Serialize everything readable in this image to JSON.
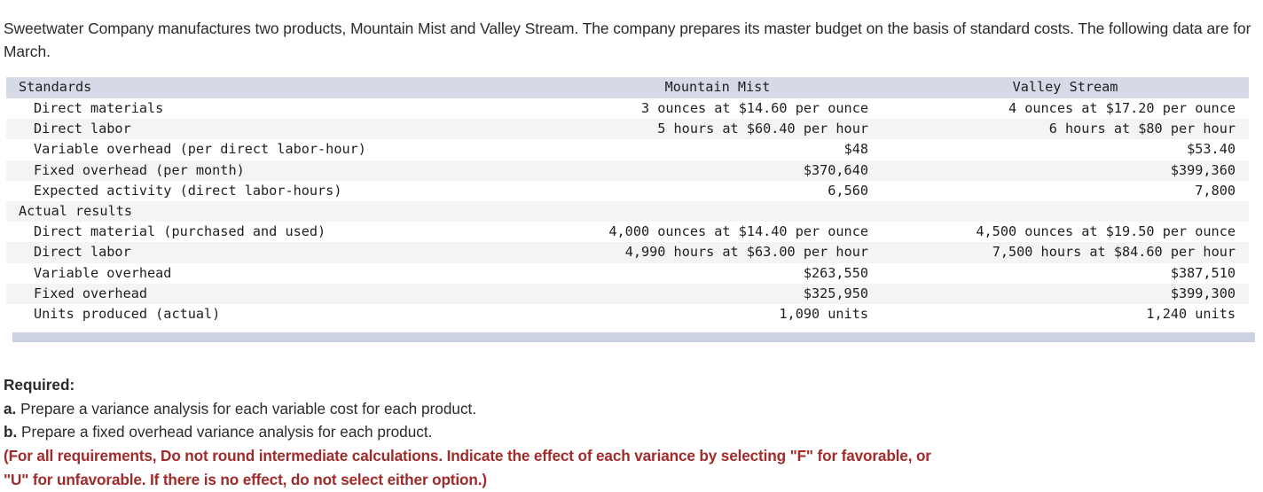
{
  "intro": {
    "paragraph": "Sweetwater Company manufactures two products, Mountain Mist and Valley Stream. The company prepares its master budget on the basis of standard costs. The following data are for March."
  },
  "table": {
    "columns": {
      "label": "Standards",
      "mountain_mist": "Mountain Mist",
      "valley_stream": "Valley Stream"
    },
    "sections": [
      {
        "title": "Standards",
        "rows": [
          {
            "label": "Direct materials",
            "mountain_mist": "3 ounces at $14.60 per ounce",
            "valley_stream": "4 ounces at $17.20 per ounce"
          },
          {
            "label": "Direct labor",
            "mountain_mist": "5 hours at $60.40 per hour",
            "valley_stream": "6 hours at $80 per hour"
          },
          {
            "label": "Variable overhead (per direct labor-hour)",
            "mountain_mist": "$48",
            "valley_stream": "$53.40"
          },
          {
            "label": "Fixed overhead (per month)",
            "mountain_mist": "$370,640",
            "valley_stream": "$399,360"
          },
          {
            "label": "Expected activity (direct labor-hours)",
            "mountain_mist": "6,560",
            "valley_stream": "7,800"
          }
        ]
      },
      {
        "title": "Actual results",
        "rows": [
          {
            "label": "Direct material (purchased and used)",
            "mountain_mist": "4,000 ounces at $14.40 per ounce",
            "valley_stream": "4,500 ounces at $19.50 per ounce"
          },
          {
            "label": "Direct labor",
            "mountain_mist": "4,990 hours at $63.00 per hour",
            "valley_stream": "7,500 hours at $84.60 per hour"
          },
          {
            "label": "Variable overhead",
            "mountain_mist": "$263,550",
            "valley_stream": "$387,510"
          },
          {
            "label": "Fixed overhead",
            "mountain_mist": "$325,950",
            "valley_stream": "$399,300"
          },
          {
            "label": "Units produced (actual)",
            "mountain_mist": "1,090 units",
            "valley_stream": "1,240 units"
          }
        ]
      }
    ]
  },
  "required": {
    "heading": "Required:",
    "item_a_marker": "a.",
    "item_a_text": " Prepare a variance analysis for each variable cost for each product.",
    "item_b_marker": "b.",
    "item_b_text": " Prepare a fixed overhead variance analysis for each product.",
    "note_line_1": "(For all requirements, Do not round intermediate calculations. Indicate the effect of each variance by selecting \"F\" for favorable, or",
    "note_line_2": "\"U\" for unfavorable. If there is no effect, do not select either option.)"
  },
  "colors": {
    "header_band": "#d5dae6",
    "stripe": "#f4f4f4",
    "footer_band": "#ccd2e2",
    "note_red": "#a02b2b",
    "text": "#262626"
  }
}
